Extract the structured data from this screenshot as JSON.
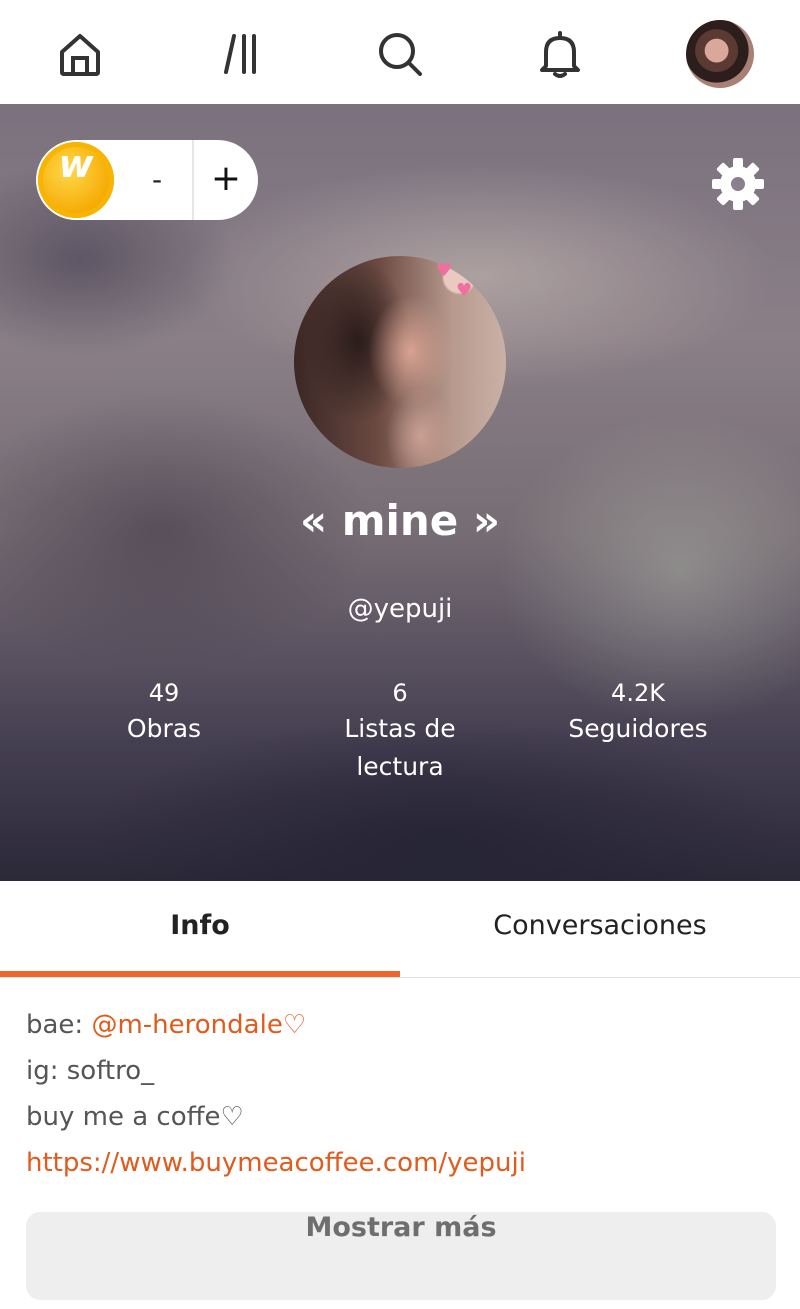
{
  "nav": {
    "items": [
      "home",
      "library",
      "search",
      "notifications",
      "profile"
    ]
  },
  "wallet": {
    "coin_letter": "w",
    "minus_label": "-",
    "plus_label": "+"
  },
  "profile": {
    "display_name": "« mine »",
    "username": "@yepuji",
    "stats": [
      {
        "value": "49",
        "label": "Obras"
      },
      {
        "value": "6",
        "label": "Listas de lectura"
      },
      {
        "value": "4.2K",
        "label": "Seguidores"
      }
    ]
  },
  "tabs": [
    {
      "label": "Info",
      "active": true
    },
    {
      "label": "Conversaciones",
      "active": false
    }
  ],
  "bio": {
    "line1_prefix": "bae: ",
    "line1_mention": "@m-herondale♡",
    "line2": "ig: softro_",
    "line3": "buy me a coffe♡",
    "line4_link": "https://www.buymeacoffee.com/yepuji"
  },
  "show_more_label": "Mostrar más",
  "colors": {
    "accent": "#f0642e",
    "link": "#e25a1c",
    "coin": "#f5a800"
  }
}
